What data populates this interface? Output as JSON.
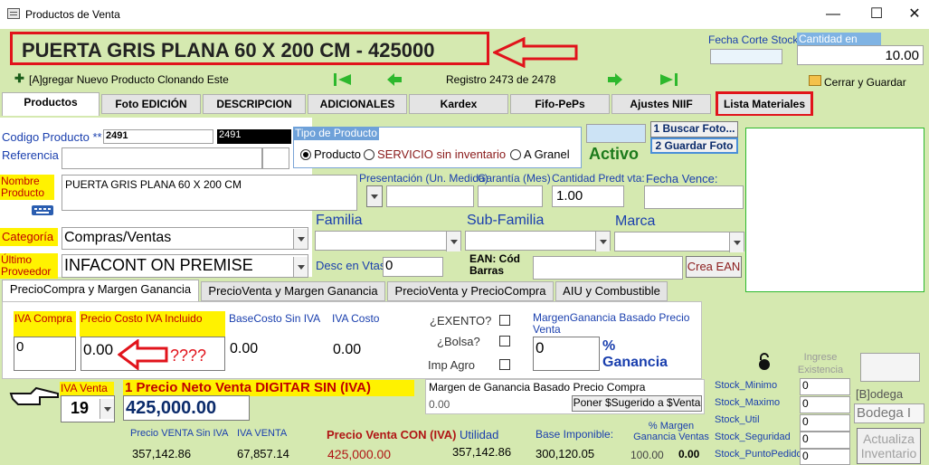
{
  "window": {
    "title": "Productos de Venta",
    "minimize": "—",
    "maximize": "☐",
    "close": "✕"
  },
  "header": {
    "product_title": "PUERTA GRIS PLANA 60 X 200 CM - 425000",
    "fecha_corte_label": "Fecha Corte Stock",
    "fecha_corte_value": "",
    "cantidad_stock_label": "Cantidad en Stock",
    "cantidad_stock_value": "10.00"
  },
  "toolbar": {
    "clone_label": "[A]gregar Nuevo Producto Clonando Este",
    "registro": "Registro 2473 de 2478",
    "save_close": "Cerrar y Guardar"
  },
  "tabs": [
    "Productos",
    "Foto EDICIÓN",
    "DESCRIPCION",
    "ADICIONALES",
    "Kardex",
    "Fifo-PePs",
    "Ajustes NIIF",
    "Lista Materiales"
  ],
  "form": {
    "codigo_label": "Codigo Producto **",
    "codigo_value": "2491",
    "codigo_value2": "2491",
    "referencia_label": "Referencia",
    "referencia_value": "",
    "tipo_label": "Tipo de Producto",
    "tipo_options": [
      "Producto",
      "SERVICIO sin inventario",
      "A Granel"
    ],
    "buscar_foto": "1 Buscar Foto...",
    "guardar_foto": "2 Guardar Foto",
    "activo": "Activo",
    "nombre_label": "Nombre Producto",
    "nombre_value": "PUERTA GRIS PLANA 60 X 200 CM",
    "presentacion_label": "Presentación (Un. Medida)",
    "garantia_label": "Garantía (Mes)",
    "cantidad_predt_label": "Cantidad Predt vta:",
    "cantidad_predt_value": "1.00",
    "fecha_vence_label": "Fecha Vence:",
    "categoria_label": "Categoría",
    "categoria_value": "Compras/Ventas",
    "familia_label": "Familia",
    "subfamilia_label": "Sub-Familia",
    "marca_label": "Marca",
    "proveedor_label": "Último Proveedor",
    "proveedor_value": "INFACONT ON PREMISE",
    "desc_vtas_label": "Desc en Vtas",
    "desc_vtas_value": "0",
    "ean_label": "EAN: Cód Barras",
    "crea_ean": "Crea EAN"
  },
  "subtabs": [
    "PrecioCompra y Margen Ganancia",
    "PrecioVenta y Margen Ganancia",
    "PrecioVenta y PrecioCompra",
    "AIU y Combustible"
  ],
  "pricing": {
    "iva_compra_label": "IVA Compra",
    "iva_compra_value": "0",
    "precio_costo_label": "Precio Costo IVA Incluido",
    "precio_costo_value": "0.00",
    "question": "????",
    "base_costo_label": "BaseCosto Sin IVA",
    "base_costo_value": "0.00",
    "iva_costo_label": "IVA Costo",
    "iva_costo_value": "0.00",
    "exento_label": "¿EXENTO?",
    "bolsa_label": "¿Bolsa?",
    "imp_agro_label": "Imp Agro",
    "margen_label": "MargenGanancia Basado Precio Venta",
    "margen_value": "0",
    "ganancia_label": "% Ganancia"
  },
  "venta": {
    "iva_venta_label": "IVA Venta",
    "iva_venta_value": "19",
    "precio_neto_label": "1 Precio Neto Venta DIGITAR SIN (IVA)",
    "precio_neto_value": "425,000.00",
    "margen_precio_compra_label": "Margen de Ganancia Basado Precio Compra",
    "margen_precio_compra_value": "0.00",
    "poner_sugerido": "Poner $Sugerido a $Venta",
    "precio_sin_iva_label": "Precio VENTA Sin IVA",
    "precio_sin_iva_value": "357,142.86",
    "iva_venta2_label": "IVA VENTA",
    "iva_venta2_value": "67,857.14",
    "precio_con_iva_label": "Precio Venta CON (IVA)",
    "precio_con_iva_value": "425,000.00",
    "utilidad_label": "Utilidad",
    "utilidad_value": "357,142.86",
    "base_imponible_label": "Base Imponible:",
    "base_imponible_value": "300,120.05",
    "base_imponible_value2": "100.00",
    "margen_ventas_label": "% Margen Ganancia Ventas",
    "margen_ventas_value": "0.00"
  },
  "stock": {
    "ingreso_label": "Ingrese Existencia",
    "items": [
      {
        "label": "Stock_Minimo",
        "value": "0"
      },
      {
        "label": "Stock_Maximo",
        "value": "0"
      },
      {
        "label": "Stock_Util",
        "value": "0"
      },
      {
        "label": "Stock_Seguridad",
        "value": "0"
      },
      {
        "label": "Stock_PuntoPedido",
        "value": "0"
      }
    ],
    "bodega_label": "[B]odega",
    "bodega_value": "Bodega I",
    "actualiza": "Actualiza Inventario"
  },
  "colors": {
    "accent_red": "#e1131b",
    "panel_green": "#d5e9b0",
    "label_blue": "#1a3fae",
    "yellow": "#fff200"
  }
}
